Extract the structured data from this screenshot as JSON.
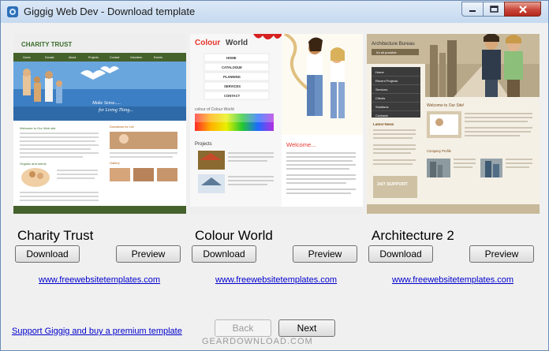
{
  "window": {
    "title": "Giggig Web Dev - Download template"
  },
  "templates": [
    {
      "name": "Charity Trust",
      "download_label": "Download",
      "preview_label": "Preview",
      "link_text": "www.freewebsitetemplates.com",
      "thumb": {
        "logo": "CHARITY TRUST",
        "nav": [
          "Home",
          "Donate",
          "About",
          "Projects",
          "Contact",
          "Volunteer",
          "Events"
        ],
        "banner_line1": "Make Sense.....",
        "banner_line2": "for Living Thing...",
        "section1": "Welcome to Our Web site",
        "section2": "Donations for Us!",
        "section3": "Organic and seeds",
        "section4": "Gallery"
      }
    },
    {
      "name": "Colour World",
      "download_label": "Download",
      "preview_label": "Preview",
      "link_text": "www.freewebsitetemplates.com",
      "thumb": {
        "logo_a": "Colour",
        "logo_b": "World",
        "menu": [
          "HOME",
          "CATALOGUE",
          "PLANNING",
          "SERVICES",
          "CONTACT"
        ],
        "sub_logo": "colour of Colour World",
        "projects": "Projects",
        "welcome": "Welcome..."
      }
    },
    {
      "name": "Architecture 2",
      "download_label": "Download",
      "preview_label": "Preview",
      "link_text": "www.freewebsitetemplates.com",
      "thumb": {
        "logo": "Architecture Bureau",
        "tagline": "it's all possible",
        "menu": [
          "Home",
          "Recent Projects",
          "Services",
          "Clients",
          "Solutions",
          "Contacts"
        ],
        "latest_news": "Latest News",
        "welcome": "Welcome to Our Site!",
        "company_profile": "Company Profile",
        "support": "24/7 SUPPORT"
      }
    }
  ],
  "nav": {
    "back_label": "Back",
    "next_label": "Next"
  },
  "support_link": "Support Giggig and buy a premium template",
  "watermark": "GEARDOWNLOAD.COM"
}
